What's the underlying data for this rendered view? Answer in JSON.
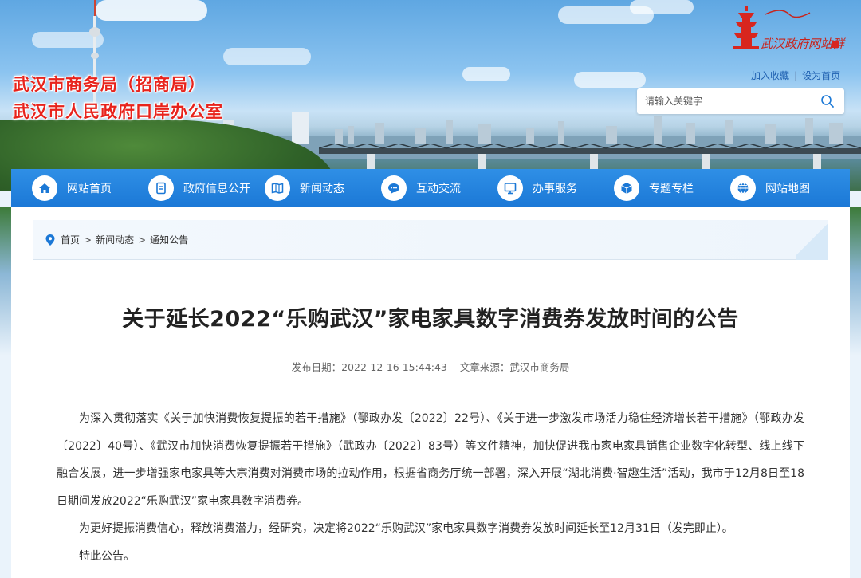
{
  "site": {
    "title_line1": "武汉市商务局（招商局）",
    "title_line2": "武汉市人民政府口岸办公室",
    "logo_text": "武汉政府网站群"
  },
  "top_links": {
    "bookmark": "加入收藏",
    "separator": "|",
    "homepage": "设为首页"
  },
  "search": {
    "placeholder": "请输入关键字"
  },
  "nav": {
    "items": [
      {
        "label": "网站首页",
        "icon": "home-icon"
      },
      {
        "label": "政府信息公开",
        "icon": "document-icon"
      },
      {
        "label": "新闻动态",
        "icon": "newspaper-icon"
      },
      {
        "label": "互动交流",
        "icon": "chat-icon"
      },
      {
        "label": "办事服务",
        "icon": "monitor-icon"
      },
      {
        "label": "专题专栏",
        "icon": "cube-icon"
      },
      {
        "label": "网站地图",
        "icon": "globe-icon"
      }
    ]
  },
  "breadcrumb": {
    "home": "首页",
    "level2": "新闻动态",
    "level3": "通知公告",
    "sep": ">"
  },
  "article": {
    "title": "关于延长2022“乐购武汉”家电家具数字消费券发放时间的公告",
    "date_label": "发布日期：2022-12-16 15:44:43",
    "source_label": "文章来源：武汉市商务局",
    "paragraphs": [
      "为深入贯彻落实《关于加快消费恢复提振的若干措施》（鄂政办发〔2022〕22号）、《关于进一步激发市场活力稳住经济增长若干措施》（鄂政办发〔2022〕40号）、《武汉市加快消费恢复提振若干措施》（武政办〔2022〕83号）等文件精神，加快促进我市家电家具销售企业数字化转型、线上线下融合发展，进一步增强家电家具等大宗消费对消费市场的拉动作用，根据省商务厅统一部署，深入开展“湖北消费·智趣生活”活动，我市于12月8日至18日期间发放2022“乐购武汉”家电家具数字消费券。",
      "为更好提振消费信心，释放消费潜力，经研究，决定将2022“乐购武汉”家电家具数字消费券发放时间延长至12月31日（发完即止）。",
      "特此公告。"
    ]
  },
  "colors": {
    "nav_blue": "#1b78d6",
    "title_red": "#e8231c",
    "link_blue": "#1d5fb0"
  }
}
